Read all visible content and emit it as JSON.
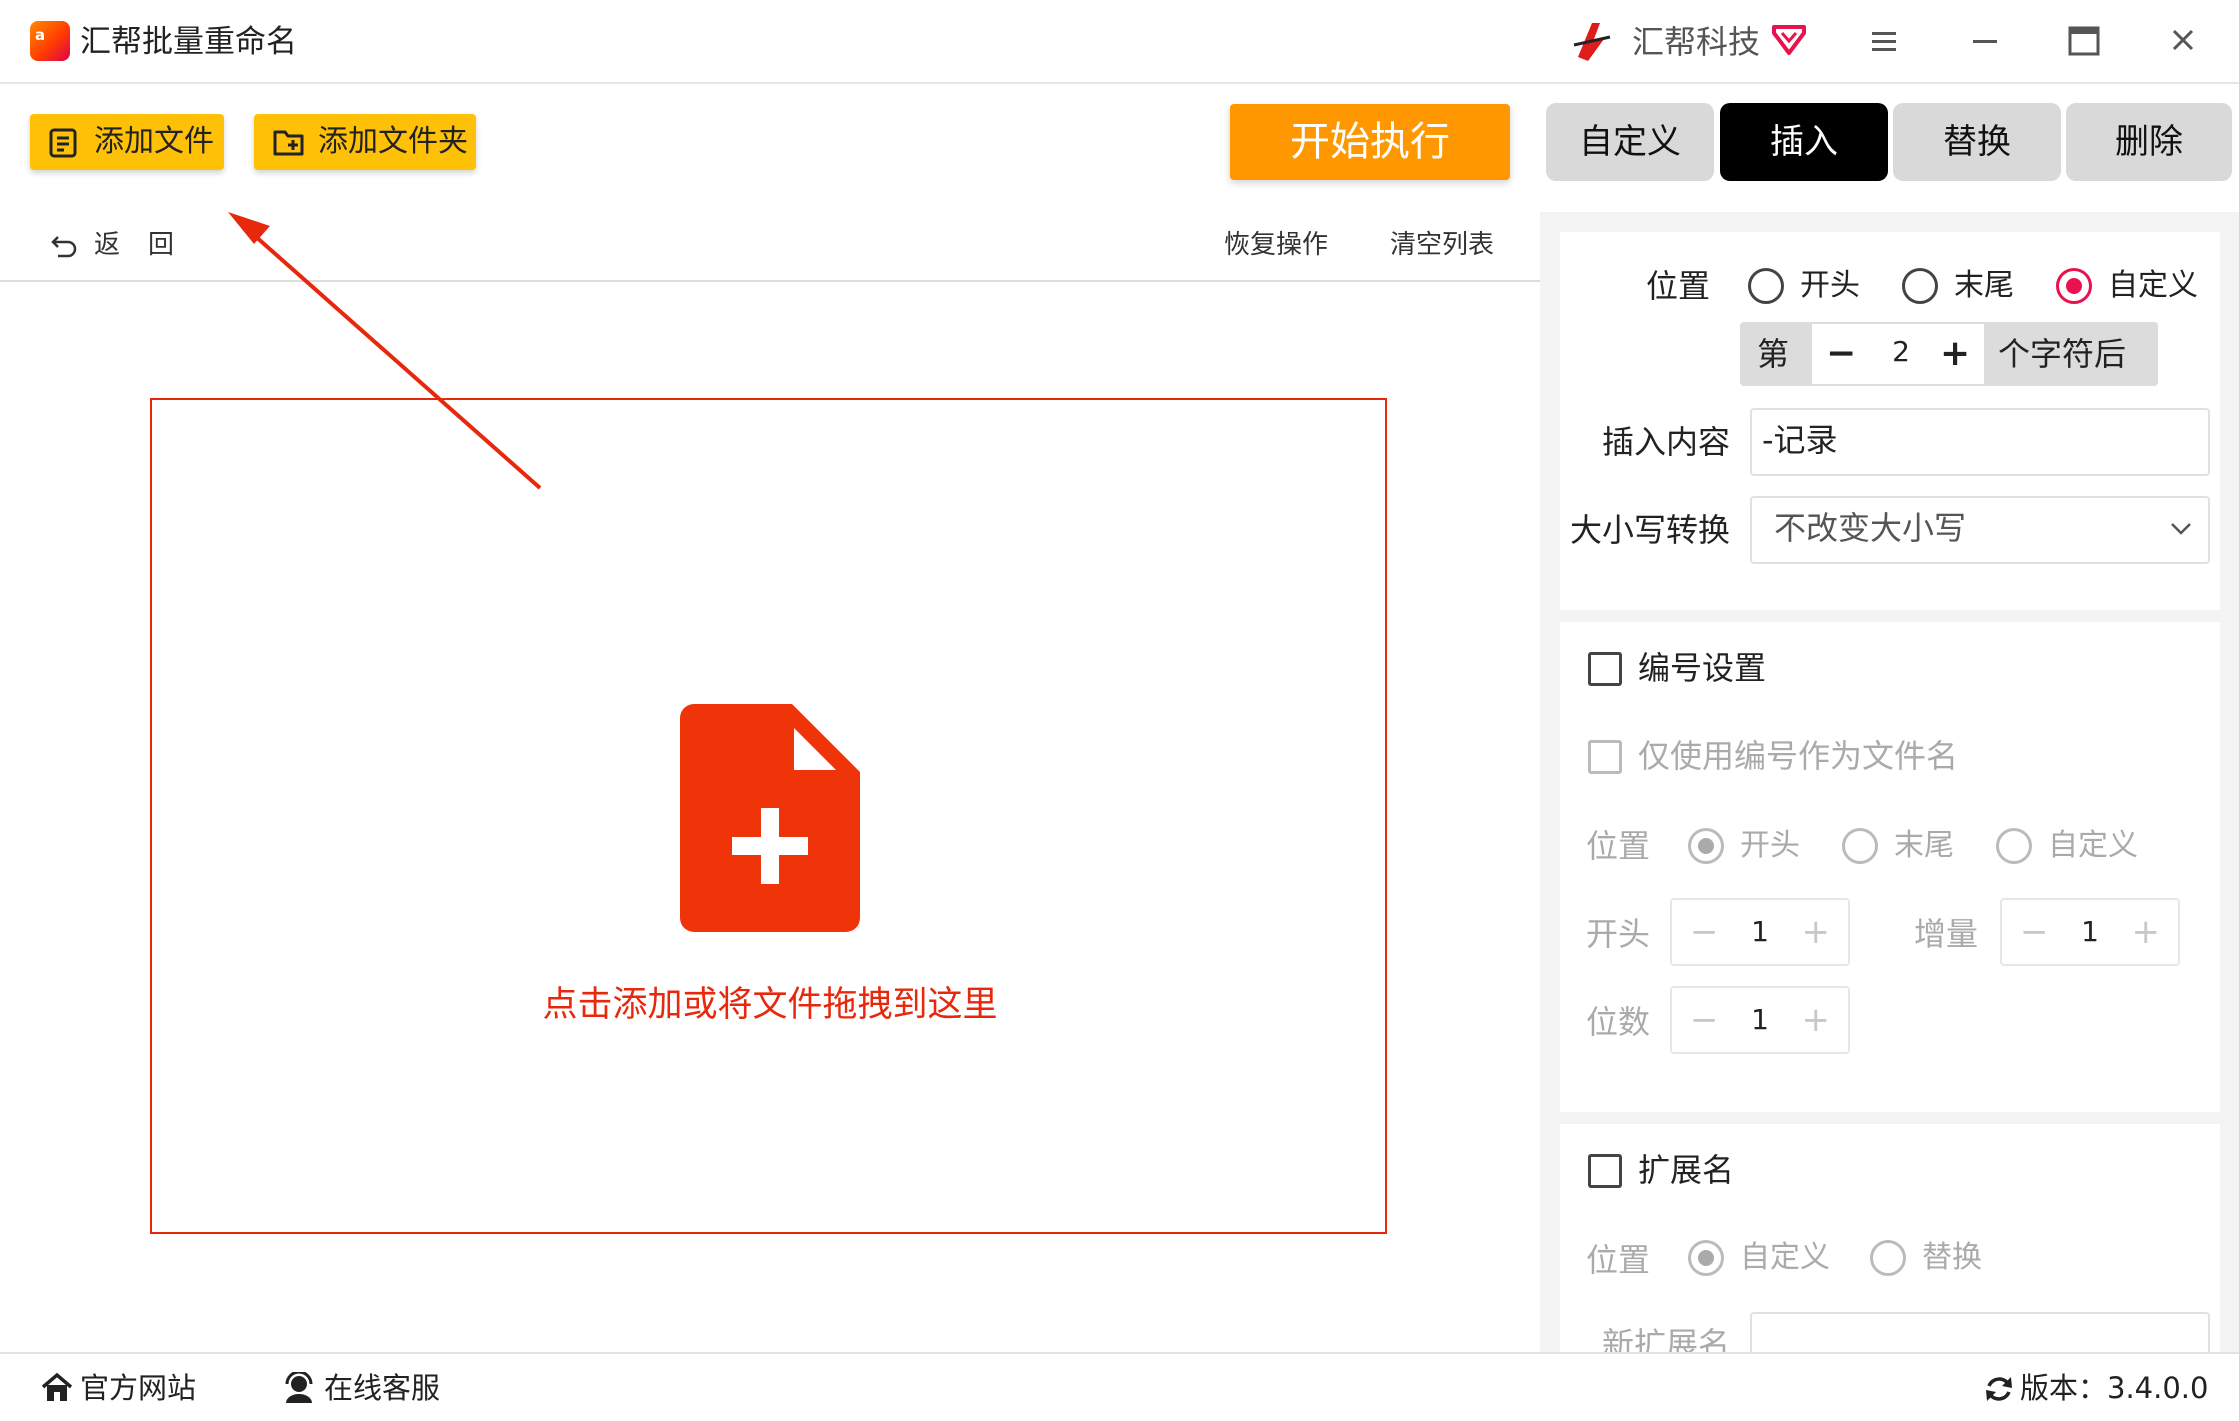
{
  "app": {
    "title": "汇帮批量重命名",
    "logo_text": "a",
    "brand_name": "汇帮科技"
  },
  "toolbar": {
    "add_file_label": "添加文件",
    "add_folder_label": "添加文件夹",
    "start_label": "开始执行"
  },
  "tabs": [
    {
      "label": "自定义",
      "active": false
    },
    {
      "label": "插入",
      "active": true
    },
    {
      "label": "替换",
      "active": false
    },
    {
      "label": "删除",
      "active": false
    }
  ],
  "subbar": {
    "back_label": "返回",
    "restore_label": "恢复操作",
    "clear_label": "清空列表"
  },
  "dropzone": {
    "text": "点击添加或将文件拖拽到这里"
  },
  "insert": {
    "position_label": "位置",
    "position_options": [
      "开头",
      "末尾",
      "自定义"
    ],
    "position_selected": "自定义",
    "stepper_prefix": "第",
    "stepper_minus": "−",
    "stepper_value": "2",
    "stepper_plus": "+",
    "stepper_suffix": "个字符后",
    "content_label": "插入内容",
    "content_value": "-记录",
    "case_label": "大小写转换",
    "case_value": "不改变大小写"
  },
  "numbering": {
    "title": "编号设置",
    "enabled": false,
    "only_number_label": "仅使用编号作为文件名",
    "position_label": "位置",
    "position_options": [
      "开头",
      "末尾",
      "自定义"
    ],
    "position_selected": "开头",
    "start_label": "开头",
    "start_value": "1",
    "increment_label": "增量",
    "increment_value": "1",
    "digits_label": "位数",
    "digits_value": "1",
    "minus": "−",
    "plus": "+"
  },
  "extension": {
    "title": "扩展名",
    "enabled": false,
    "position_label": "位置",
    "position_options": [
      "自定义",
      "替换"
    ],
    "position_selected": "自定义",
    "new_ext_label": "新扩展名"
  },
  "statusbar": {
    "site_label": "官方网站",
    "service_label": "在线客服",
    "version_label": "版本：3.4.0.0"
  },
  "colors": {
    "accent_yellow": "#ffc107",
    "start_orange": "#ff9800",
    "drop_red": "#e8280c",
    "radio_pink": "#e8124f"
  }
}
